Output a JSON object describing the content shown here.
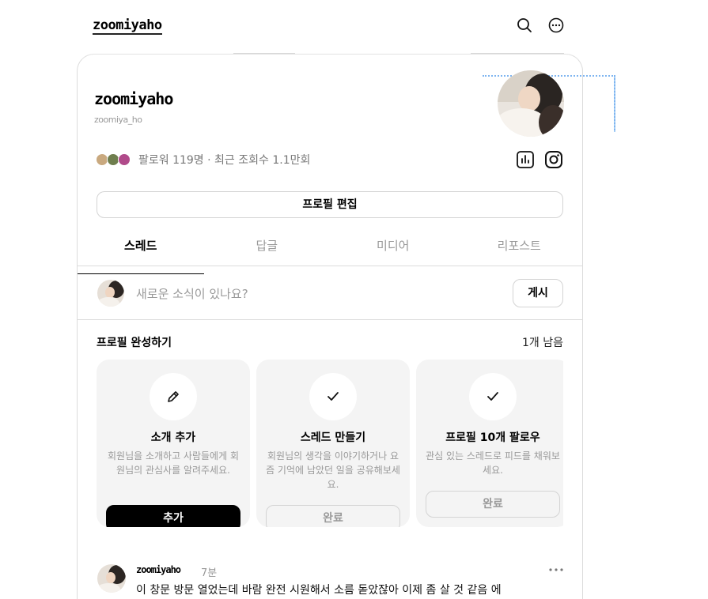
{
  "header": {
    "logo_text": "zoomiyaho"
  },
  "profile": {
    "name": "zoomiyaho",
    "handle": "zoomiya_ho",
    "followers_text": "팔로워 119명 · 최근 조회수 1.1만회",
    "edit_profile_label": "프로필 편집"
  },
  "tabs": [
    {
      "label": "스레드"
    },
    {
      "label": "답글"
    },
    {
      "label": "미디어"
    },
    {
      "label": "리포스트"
    }
  ],
  "composer": {
    "placeholder": "새로운 소식이 있나요?",
    "post_label": "게시"
  },
  "completion": {
    "title": "프로필 완성하기",
    "remaining": "1개 남음",
    "cards": [
      {
        "icon": "pencil-icon",
        "title": "소개 추가",
        "description": "회원님을 소개하고 사람들에게 회원님의 관심사를 알려주세요.",
        "button": "추가",
        "state": "primary"
      },
      {
        "icon": "check-icon",
        "title": "스레드 만들기",
        "description": "회원님의 생각을 이야기하거나 요즘 기억에 남았던 일을 공유해보세요.",
        "button": "완료",
        "state": "done"
      },
      {
        "icon": "check-icon",
        "title": "프로필 10개 팔로우",
        "description": "관심 있는 스레드로 피드를 채워보세요.",
        "button": "완료",
        "state": "done"
      }
    ]
  },
  "post": {
    "username": "zoomiyaho",
    "time": "7분",
    "text": "이 창문 방문 열었는데 바람 완전 시원해서 소름 돋았잖아 이제 좀 살 것 같음 에"
  },
  "colors": {
    "accent": "#000000",
    "muted_text": "#999999",
    "card_bg": "#f4f4f4",
    "border": "#dcdcdc",
    "guide_blue": "#7fb5f0"
  }
}
